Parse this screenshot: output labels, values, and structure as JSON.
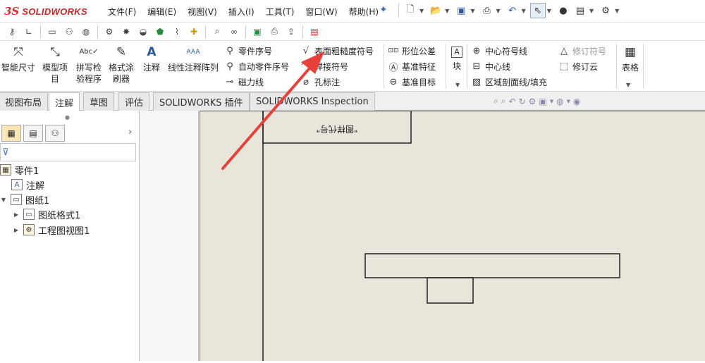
{
  "app": {
    "logo_ds": "3S",
    "logo_name": "SOLIDWORKS"
  },
  "menu": [
    "文件(F)",
    "编辑(E)",
    "视图(V)",
    "插入(I)",
    "工具(T)",
    "窗口(W)",
    "帮助(H)"
  ],
  "ribbon": {
    "smart_dimension": "智能尺寸",
    "model_items": "模型项目",
    "spell_checker": "拼写检验程序",
    "format_painter": "格式涂刷器",
    "note": "注释",
    "linear_note_pattern": "线性注释阵列",
    "balloon": "零件序号",
    "auto_balloon": "自动零件序号",
    "magnetic_line": "磁力线",
    "surface_finish": "表面粗糙度符号",
    "weld_symbol": "焊接符号",
    "hole_callout": "孔标注",
    "gtol": "形位公差",
    "datum_feature": "基准特征",
    "datum_target": "基准目标",
    "blocks": "块",
    "center_mark": "中心符号线",
    "centerline": "中心线",
    "area_hatch": "区域剖面线/填充",
    "revision_symbol": "修订符号",
    "revision_cloud": "修订云",
    "tables": "表格"
  },
  "tabs": [
    "视图布局",
    "注解",
    "草图",
    "评估",
    "SOLIDWORKS 插件",
    "SOLIDWORKS Inspection"
  ],
  "active_tab": "注解",
  "tree": {
    "part": "零件1",
    "annotations": "注解",
    "sheet": "图纸1",
    "sheet_format": "图纸格式1",
    "drawing_view": "工程图视图1"
  },
  "drawing": {
    "title_text": "\"图样代号\""
  },
  "colors": {
    "arrow": "#e8413c",
    "paper": "#e8e5da",
    "accent": "#3a6fb5"
  }
}
